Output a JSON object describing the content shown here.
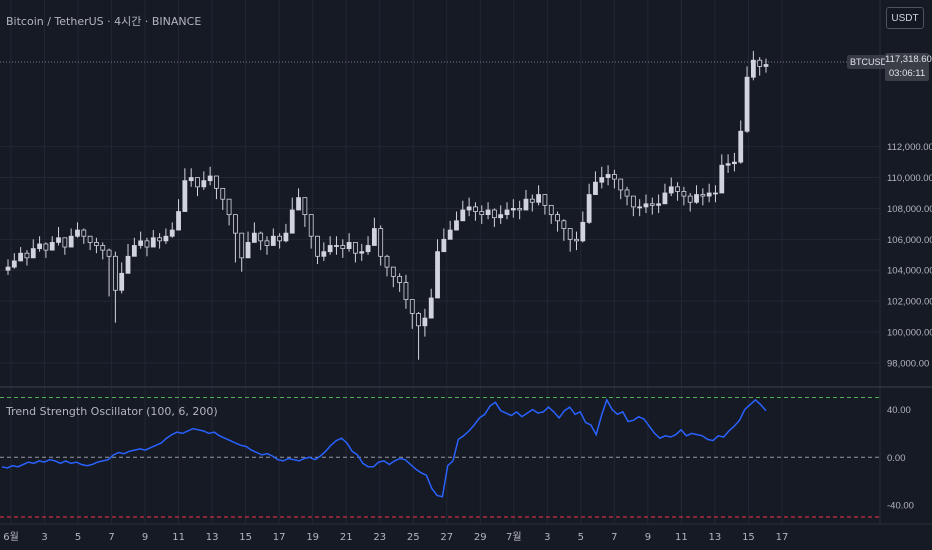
{
  "header": {
    "title": "Bitcoin / TetherUS · 4시간 · BINANCE",
    "currency_button": "USDT"
  },
  "price_badge": {
    "symbol": "BTCUSDT",
    "price": "117,318.60",
    "countdown": "03:06:11"
  },
  "indicator": {
    "title": "Trend Strength Oscillator (100, 6, 200)"
  },
  "colors": {
    "background": "#161a25",
    "grid": "#232733",
    "candle": "#d1d4dc",
    "oscillator_line": "#2962ff",
    "upper_level": "#4caf50",
    "zero_level": "#9598a1",
    "lower_level": "#f23645"
  },
  "chart_data": [
    {
      "type": "candlestick",
      "title": "Bitcoin / TetherUS · 4시간 · BINANCE",
      "y_ticks": [
        "98,000.00",
        "100,000.00",
        "102,000.00",
        "104,000.00",
        "106,000.00",
        "108,000.00",
        "110,000.00",
        "112,000.00"
      ],
      "ylim": [
        96500,
        121500
      ],
      "last_price": 117318.6,
      "x_ticks": [
        "6월",
        "3",
        "5",
        "7",
        "9",
        "11",
        "13",
        "15",
        "17",
        "19",
        "21",
        "23",
        "25",
        "27",
        "29",
        "7월",
        "3",
        "5",
        "7",
        "9",
        "11",
        "13",
        "15",
        "17"
      ],
      "close": [
        104200,
        104600,
        105100,
        104800,
        105400,
        105700,
        105300,
        105800,
        106100,
        105500,
        106200,
        106600,
        106200,
        105800,
        105600,
        105300,
        104900,
        102700,
        103800,
        104900,
        105600,
        105900,
        105500,
        106100,
        105900,
        106200,
        106600,
        107800,
        109800,
        110000,
        109400,
        109800,
        110100,
        109300,
        108600,
        107600,
        106400,
        104800,
        105800,
        106400,
        105900,
        105600,
        106200,
        105900,
        106400,
        107900,
        108700,
        107600,
        106200,
        104900,
        105200,
        105600,
        105600,
        105400,
        105800,
        105100,
        105200,
        105600,
        106700,
        104900,
        104200,
        103600,
        103200,
        102100,
        101200,
        100400,
        100900,
        102200,
        105200,
        106000,
        106600,
        107200,
        107900,
        108100,
        107800,
        107600,
        107900,
        107400,
        107600,
        107900,
        108000,
        107900,
        108600,
        108400,
        108900,
        108200,
        107600,
        107200,
        106700,
        106000,
        105900,
        107100,
        108900,
        109700,
        110000,
        110200,
        109900,
        109200,
        108800,
        108100,
        108100,
        108300,
        108200,
        108300,
        109000,
        109400,
        109100,
        108800,
        108400,
        108900,
        108800,
        109000,
        109000,
        110800,
        110900,
        111000,
        113000,
        116500,
        117600,
        117200,
        117318.6
      ],
      "high": [
        104700,
        105100,
        105500,
        105300,
        106000,
        106200,
        105800,
        106200,
        106800,
        106000,
        106700,
        107100,
        106700,
        106200,
        106100,
        105800,
        105400,
        105200,
        104500,
        105700,
        106100,
        106500,
        106100,
        106600,
        106400,
        106700,
        107100,
        108600,
        110600,
        110600,
        110000,
        110400,
        110700,
        109900,
        109200,
        108200,
        107000,
        106300,
        106500,
        107100,
        106500,
        106200,
        106700,
        106400,
        107000,
        108700,
        109300,
        108300,
        106800,
        105800,
        105800,
        106200,
        106200,
        106000,
        106400,
        105700,
        105700,
        106200,
        107400,
        106900,
        105000,
        104200,
        103800,
        103700,
        101800,
        101300,
        101500,
        102800,
        106000,
        106700,
        107200,
        107800,
        108500,
        108700,
        108400,
        108200,
        108400,
        108000,
        108200,
        108400,
        108600,
        108500,
        109200,
        108900,
        109500,
        108800,
        108200,
        107800,
        107300,
        106600,
        106500,
        107800,
        109600,
        110400,
        110700,
        110800,
        110500,
        109900,
        109400,
        108700,
        108600,
        108900,
        108700,
        108900,
        109600,
        110000,
        109700,
        109400,
        109000,
        109500,
        109300,
        109600,
        109500,
        111500,
        111500,
        111600,
        113700,
        117200,
        118200,
        117800,
        117700
      ],
      "low": [
        103700,
        104100,
        104600,
        104300,
        104900,
        105200,
        104800,
        105300,
        105600,
        105000,
        105700,
        106100,
        105700,
        105300,
        105100,
        104700,
        102300,
        100600,
        102500,
        104300,
        105100,
        105400,
        104900,
        105600,
        105400,
        105700,
        106100,
        107200,
        107900,
        109400,
        108800,
        109200,
        109500,
        108600,
        107900,
        106900,
        104500,
        103900,
        104900,
        105800,
        105300,
        105000,
        105600,
        105400,
        105800,
        107300,
        107900,
        106800,
        105400,
        104400,
        104600,
        105000,
        105000,
        104800,
        105200,
        104500,
        104600,
        105000,
        106000,
        104300,
        103600,
        102900,
        102600,
        101500,
        100200,
        98200,
        99700,
        100900,
        102200,
        105400,
        106000,
        106600,
        107300,
        107500,
        107200,
        107000,
        107300,
        106800,
        107000,
        107300,
        107400,
        107300,
        107900,
        107800,
        108200,
        107600,
        107000,
        106500,
        105900,
        105200,
        105300,
        105800,
        107000,
        109000,
        109300,
        109500,
        109300,
        108600,
        108200,
        107500,
        107500,
        107700,
        107600,
        107700,
        108400,
        108800,
        108500,
        108200,
        107800,
        108300,
        108200,
        108400,
        108400,
        109000,
        110300,
        110400,
        110900,
        112900,
        116300,
        116600,
        116800
      ]
    },
    {
      "type": "line",
      "title": "Trend Strength Oscillator (100, 6, 200)",
      "y_ticks": [
        "40.00",
        "0.00",
        "-40.00"
      ],
      "ylim": [
        -55,
        58
      ],
      "levels": {
        "upper": 50,
        "zero": 0,
        "lower": -50
      },
      "series": [
        {
          "values": [
            -8,
            -9,
            -7,
            -8,
            -6,
            -4,
            -5,
            -3,
            -4,
            -2,
            -3,
            -5,
            -3,
            -5,
            -4,
            -6,
            -7,
            -6,
            -4,
            -3,
            -2,
            2,
            4,
            3,
            5,
            6,
            7,
            6,
            8,
            10,
            12,
            16,
            19,
            21,
            20,
            22,
            24,
            23,
            22,
            20,
            21,
            18,
            16,
            14,
            12,
            10,
            9,
            6,
            4,
            2,
            3,
            1,
            -2,
            -3,
            -1,
            -2,
            -3,
            -1,
            0,
            -2,
            1,
            5,
            10,
            14,
            16,
            12,
            5,
            2,
            -5,
            -8,
            -8,
            -4,
            -3,
            -6,
            -3,
            -1,
            -2,
            -6,
            -10,
            -13,
            -15,
            -26,
            -32,
            -33,
            -7,
            -3,
            15,
            18,
            22,
            27,
            33,
            36,
            43,
            46,
            39,
            37,
            35,
            38,
            34,
            37,
            40,
            37,
            38,
            42,
            38,
            33,
            39,
            42,
            36,
            38,
            29,
            27,
            19,
            35,
            48,
            40,
            36,
            38,
            30,
            31,
            34,
            32,
            26,
            20,
            16,
            18,
            17,
            19,
            23,
            18,
            20,
            19,
            18,
            15,
            14,
            18,
            17,
            22,
            26,
            31,
            40,
            44,
            48,
            44,
            39
          ]
        }
      ]
    }
  ]
}
